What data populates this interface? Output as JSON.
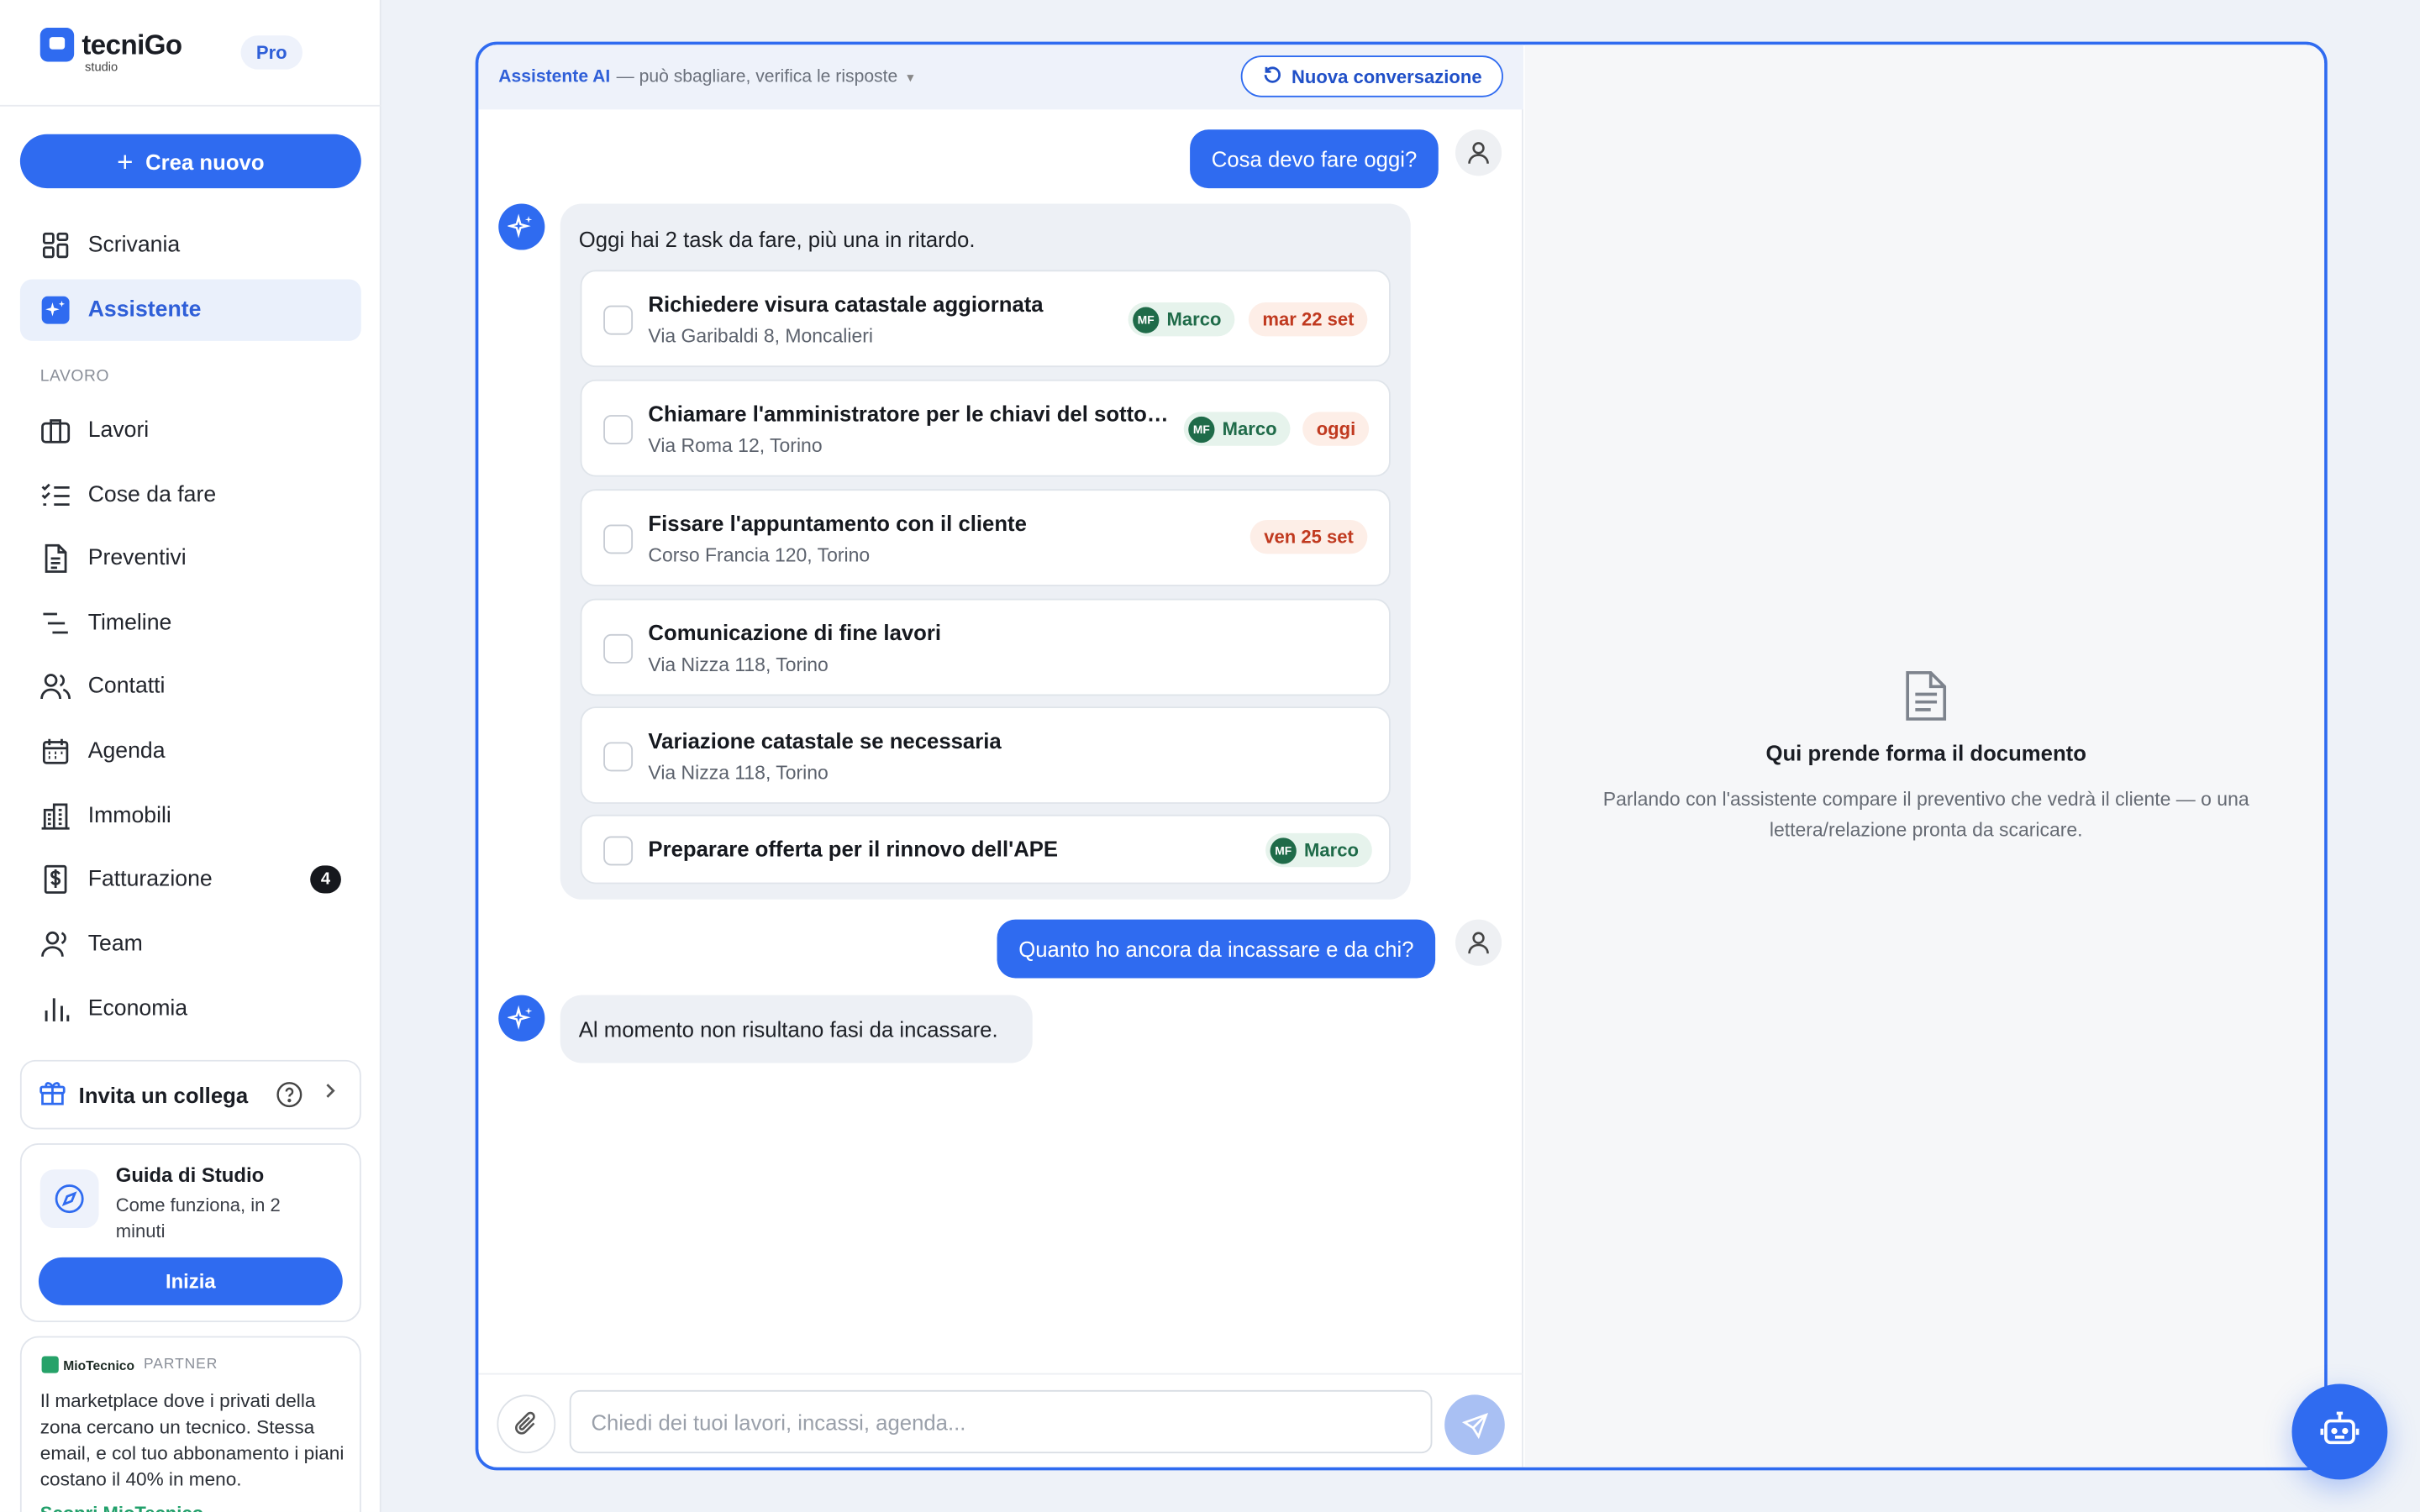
{
  "brand": {
    "name": "tecniGo",
    "sub": "studio",
    "plan": "Pro"
  },
  "sidebar": {
    "create_label": "Crea nuovo",
    "top_items": [
      {
        "label": "Scrivania",
        "icon": "dashboard-icon"
      },
      {
        "label": "Assistente",
        "icon": "sparkle-icon",
        "active": true
      }
    ],
    "section_label": "LAVORO",
    "items": [
      {
        "label": "Lavori",
        "icon": "briefcase-icon"
      },
      {
        "label": "Cose da fare",
        "icon": "checklist-icon"
      },
      {
        "label": "Preventivi",
        "icon": "document-icon"
      },
      {
        "label": "Timeline",
        "icon": "timeline-icon"
      },
      {
        "label": "Contatti",
        "icon": "users-icon"
      },
      {
        "label": "Agenda",
        "icon": "calendar-icon"
      },
      {
        "label": "Immobili",
        "icon": "building-icon"
      },
      {
        "label": "Fatturazione",
        "icon": "invoice-icon",
        "badge": "4"
      },
      {
        "label": "Team",
        "icon": "team-icon"
      },
      {
        "label": "Economia",
        "icon": "chart-icon"
      }
    ],
    "invite_label": "Invita un collega",
    "guide": {
      "title": "Guida di Studio",
      "subtitle": "Come funziona, in 2 minuti",
      "button": "Inizia"
    },
    "partner": {
      "brand": "MioTecnico",
      "tag": "PARTNER",
      "text": "Il marketplace dove i privati della zona cercano un tecnico. Stessa email, e col tuo abbonamento i piani costano il 40% in meno.",
      "link": "Scopri MioTecnico"
    }
  },
  "chat": {
    "title": "Assistente AI",
    "note": "— può sbagliare, verifica le risposte",
    "new_conversation": "Nuova conversazione",
    "messages": {
      "user1": "Cosa devo fare oggi?",
      "ai1": "Oggi hai 2 task da fare, più una in ritardo.",
      "user2": "Quanto ho ancora da incassare e da chi?",
      "ai2": "Al momento non risultano fasi da incassare."
    },
    "tasks": [
      {
        "title": "Richiedere visura catastale aggiornata",
        "address": "Via Garibaldi 8, Moncalieri",
        "assignee": "Marco",
        "initials": "MF",
        "due": "mar 22 set"
      },
      {
        "title": "Chiamare l'amministratore per le chiavi del sottotetto",
        "address": "Via Roma 12, Torino",
        "assignee": "Marco",
        "initials": "MF",
        "due": "oggi"
      },
      {
        "title": "Fissare l'appuntamento con il cliente",
        "address": "Corso Francia 120, Torino",
        "due": "ven 25 set"
      },
      {
        "title": "Comunicazione di fine lavori",
        "address": "Via Nizza 118, Torino"
      },
      {
        "title": "Variazione catastale se necessaria",
        "address": "Via Nizza 118, Torino"
      },
      {
        "title": "Preparare offerta per il rinnovo dell'APE",
        "assignee": "Marco",
        "initials": "MF"
      }
    ],
    "composer_placeholder": "Chiedi dei tuoi lavori, incassi, agenda..."
  },
  "document": {
    "title": "Qui prende forma il documento",
    "text": "Parlando con l'assistente compare il preventivo che vedrà il cliente — o una lettera/relazione pronta da scaricare."
  },
  "colors": {
    "accent": "#2f6bf0",
    "assignee": "#1f6b49",
    "due": "#c0391f"
  }
}
